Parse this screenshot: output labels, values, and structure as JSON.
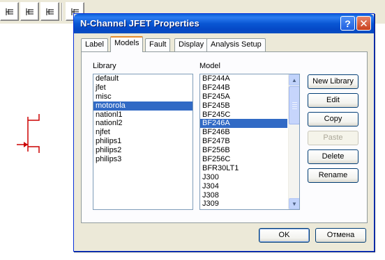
{
  "background": {
    "toolbar_icons": [
      "jfet-icon-1",
      "jfet-icon-2",
      "jfet-icon-3",
      "jfet-icon-4",
      "jfet-icon-5"
    ]
  },
  "dialog": {
    "title": "N-Channel JFET Properties",
    "help_label": "?",
    "close_label": "✕"
  },
  "tabs": [
    {
      "label": "Label",
      "active": false
    },
    {
      "label": "Models",
      "active": true
    },
    {
      "label": "Fault",
      "active": false
    },
    {
      "label": "Display",
      "active": false
    },
    {
      "label": "Analysis Setup",
      "active": false
    }
  ],
  "library": {
    "heading": "Library",
    "items": [
      "default",
      "jfet",
      "misc",
      "motorola",
      "nationl1",
      "nationl2",
      "njfet",
      "philips1",
      "philips2",
      "philips3"
    ],
    "selected": "motorola"
  },
  "model": {
    "heading": "Model",
    "items": [
      "BF244A",
      "BF244B",
      "BF245A",
      "BF245B",
      "BF245C",
      "BF246A",
      "BF246B",
      "BF247B",
      "BF256B",
      "BF256C",
      "BFR30LT1",
      "J300",
      "J304",
      "J308",
      "J309"
    ],
    "selected": "BF246A"
  },
  "buttons": {
    "new_library": "New Library",
    "edit": "Edit",
    "copy": "Copy",
    "paste": "Paste",
    "delete": "Delete",
    "rename": "Rename",
    "ok": "OK",
    "cancel": "Отмена"
  },
  "colors": {
    "title_bar": "#0a5ed8",
    "selection": "#316ac5",
    "active_tab_accent": "#e68b2c",
    "schematic_red": "#cc0000"
  }
}
